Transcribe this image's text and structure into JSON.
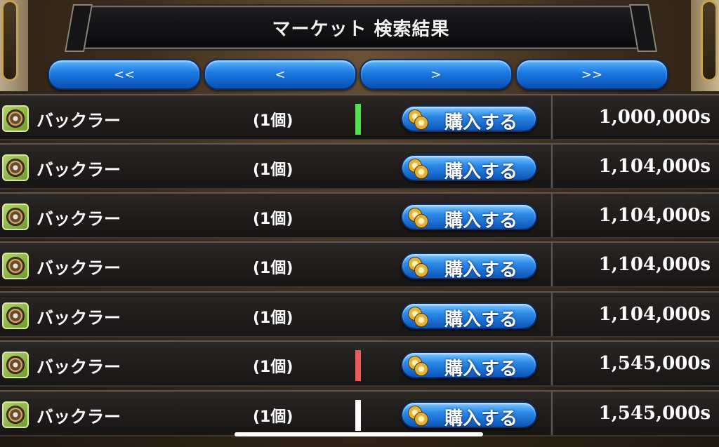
{
  "header": {
    "title": "マーケット 検索結果"
  },
  "nav": [
    "<<",
    "<",
    ">",
    ">>"
  ],
  "colors": {
    "trend_up": "#55e04f",
    "trend_down": "#ee5a5a",
    "trend_flat": "#ffffff"
  },
  "rows": [
    {
      "name": "バックラー",
      "qty": "(1個)",
      "trend": "up",
      "buy_label": "購入する",
      "price": "1,000,000s"
    },
    {
      "name": "バックラー",
      "qty": "(1個)",
      "trend": "none",
      "buy_label": "購入する",
      "price": "1,104,000s"
    },
    {
      "name": "バックラー",
      "qty": "(1個)",
      "trend": "none",
      "buy_label": "購入する",
      "price": "1,104,000s"
    },
    {
      "name": "バックラー",
      "qty": "(1個)",
      "trend": "none",
      "buy_label": "購入する",
      "price": "1,104,000s"
    },
    {
      "name": "バックラー",
      "qty": "(1個)",
      "trend": "none",
      "buy_label": "購入する",
      "price": "1,104,000s"
    },
    {
      "name": "バックラー",
      "qty": "(1個)",
      "trend": "down",
      "buy_label": "購入する",
      "price": "1,545,000s"
    },
    {
      "name": "バックラー",
      "qty": "(1個)",
      "trend": "flat",
      "buy_label": "購入する",
      "price": "1,545,000s"
    }
  ]
}
